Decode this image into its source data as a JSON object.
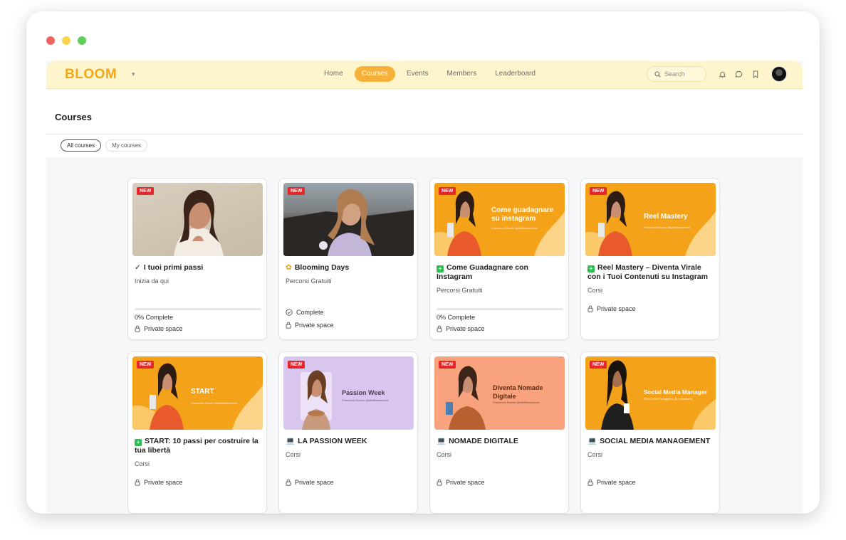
{
  "brand": {
    "logo": "BLOOM",
    "accent": "#f2a71b"
  },
  "nav": {
    "items": [
      "Home",
      "Courses",
      "Events",
      "Members",
      "Leaderboard"
    ],
    "active": "Courses"
  },
  "search": {
    "placeholder": "Search"
  },
  "page": {
    "title": "Courses"
  },
  "filters": {
    "all": "All courses",
    "mine": "My courses"
  },
  "badges": {
    "new": "NEW"
  },
  "cards": [
    {
      "title": "I tuoi primi passi",
      "icon": "check-mark-icon",
      "subtitle": "Inizia da qui",
      "status": "0% Complete",
      "access": "Private space"
    },
    {
      "title": "Blooming Days",
      "icon": "sunflower-icon",
      "subtitle": "Percorsi Gratuiti",
      "status": "Complete",
      "access": "Private space"
    },
    {
      "title": "Come Guadagnare con Instagram",
      "icon": "green-plus-icon",
      "subtitle": "Percorsi Gratuiti",
      "status": "0% Complete",
      "access": "Private space",
      "thumb_title": "Come guadagnare su instagram",
      "thumb_sub": "Francesca Runolo @wildflowermood"
    },
    {
      "title": "Reel Mastery – Diventa Virale con i Tuoi Contenuti su Instagram",
      "icon": "green-plus-icon",
      "subtitle": "Corsi",
      "access": "Private space",
      "thumb_title": "Reel Mastery",
      "thumb_sub": "Francesca Runolo @wildflowermood"
    },
    {
      "title": "START: 10 passi per costruire la tua libertà",
      "icon": "green-plus-icon",
      "subtitle": "Corsi",
      "access": "Private space",
      "thumb_title": "START",
      "thumb_sub": "Francesca Runolo @wildflowermood"
    },
    {
      "title": "LA PASSION WEEK",
      "icon": "laptop-icon",
      "subtitle": "Corsi",
      "access": "Private space",
      "thumb_title": "Passion Week",
      "thumb_sub": "Francesca Runolo @wildflowermood"
    },
    {
      "title": "NOMADE DIGITALE",
      "icon": "laptop-icon",
      "subtitle": "Corsi",
      "access": "Private space",
      "thumb_title": "Diventa Nomade Digitale",
      "thumb_sub": "Francesca Runolo @wildflowermood"
    },
    {
      "title": "SOCIAL MEDIA MANAGEMENT",
      "icon": "laptop-icon",
      "subtitle": "Corsi",
      "access": "Private space",
      "thumb_title": "Social Media Manager",
      "thumb_sub": "Karina Mas Paraggiano @_mamaland_"
    }
  ],
  "colors": {
    "orange": "#f5a21b",
    "lavender": "#d9c6ee",
    "salmon": "#f9a27e",
    "badge_red": "#e3272b"
  }
}
